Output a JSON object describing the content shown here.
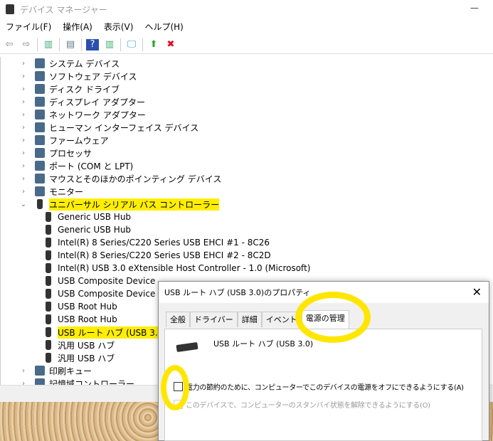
{
  "window": {
    "title": "デバイス マネージャー",
    "minimize": "—"
  },
  "menu": [
    "ファイル(F)",
    "操作(A)",
    "表示(V)",
    "ヘルプ(H)"
  ],
  "toolbar": {
    "icons": [
      "back-arrow-icon",
      "forward-arrow-icon",
      "show-hide-console-tree-icon",
      "properties-icon",
      "help-icon",
      "action-pane-icon",
      "scan-hardware-icon",
      "update-driver-icon",
      "uninstall-icon"
    ],
    "glyphs": [
      "⇦",
      "⇨",
      "▥",
      "▤",
      "?",
      "▥",
      "🖵",
      "⬆",
      "✖"
    ]
  },
  "tree": {
    "categories_top": [
      "システム デバイス",
      "ソフトウェア デバイス",
      "ディスク ドライブ",
      "ディスプレイ アダプター",
      "ネットワーク アダプター",
      "ヒューマン インターフェイス デバイス",
      "ファームウェア",
      "プロセッサ",
      "ポート (COM と LPT)",
      "マウスとそのほかのポインティング デバイス",
      "モニター"
    ],
    "expanded": "ユニバーサル シリアル バス コントローラー",
    "children": [
      "Generic USB Hub",
      "Generic USB Hub",
      "Intel(R) 8 Series/C220 Series USB EHCI #1 - 8C26",
      "Intel(R) 8 Series/C220 Series USB EHCI #2 - 8C2D",
      "Intel(R) USB 3.0 eXtensible Host Controller - 1.0 (Microsoft)",
      "USB Composite Device",
      "USB Composite Device",
      "USB Root Hub",
      "USB Root Hub",
      "USB ルート ハブ (USB 3.0)",
      "汎用 USB ハブ",
      "汎用 USB ハブ"
    ],
    "categories_bottom": [
      "印刷キュー",
      "記憶域コントローラー"
    ]
  },
  "dialog": {
    "title": "USB ルート ハブ (USB 3.0)のプロパティ",
    "close": "✕",
    "tabs": [
      "全般",
      "ドライバー",
      "詳細",
      "イベント",
      "電源の管理"
    ],
    "active_tab": "電源の管理",
    "device_name": "USB ルート ハブ (USB 3.0)",
    "options": [
      {
        "label": "電力の節約のために、コンピューターでこのデバイスの電源をオフにできるようにする(A)",
        "checked": false,
        "enabled": true
      },
      {
        "label": "このデバイスで、コンピューターのスタンバイ状態を解除できるようにする(O)",
        "checked": false,
        "enabled": false
      }
    ]
  },
  "highlight_color": "#ffee00"
}
